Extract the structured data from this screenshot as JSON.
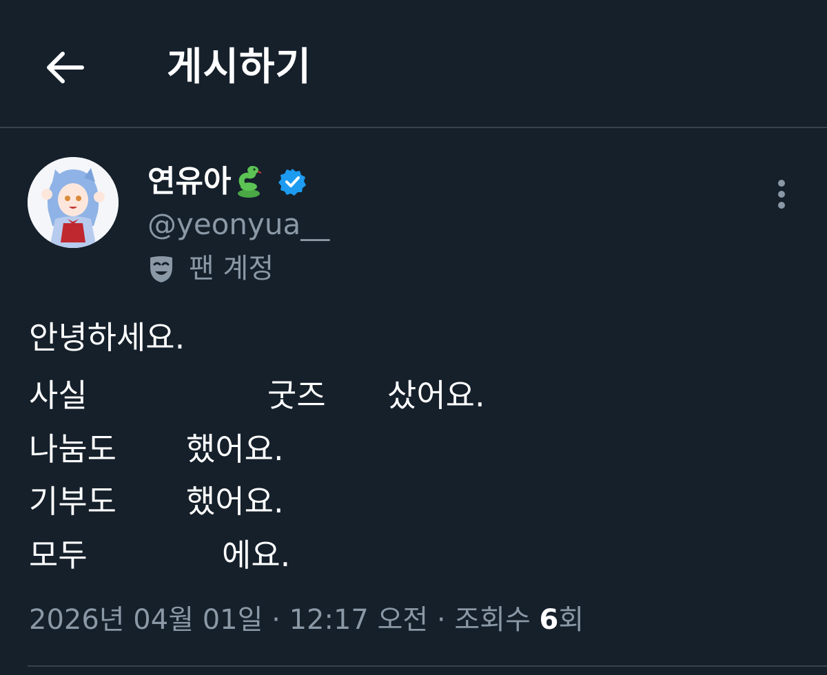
{
  "header": {
    "title": "게시하기",
    "back_icon": "arrow-left-icon"
  },
  "author": {
    "display_name": "연유아",
    "name_emoji": "snake-icon",
    "verified_icon": "verified-badge-icon",
    "verified_color": "#1d9bf0",
    "handle": "@yeonyua__",
    "account_label": "팬 계정",
    "account_icon": "theater-mask-icon"
  },
  "post": {
    "lines": [
      [
        "안녕하세요."
      ],
      [
        "사실",
        "굿즈",
        "샀어요."
      ],
      [
        "나눔도",
        "했어요."
      ],
      [
        "기부도",
        "했어요."
      ],
      [
        "모두",
        "에요."
      ]
    ]
  },
  "meta": {
    "date": "2026년 04월 01일",
    "separator": "·",
    "time": "12:17 오전",
    "views_label": "조회수",
    "views_count": "6",
    "views_suffix": "회"
  },
  "colors": {
    "background": "#15202b",
    "divider": "#38444d",
    "secondary_text": "#8b98a5"
  }
}
